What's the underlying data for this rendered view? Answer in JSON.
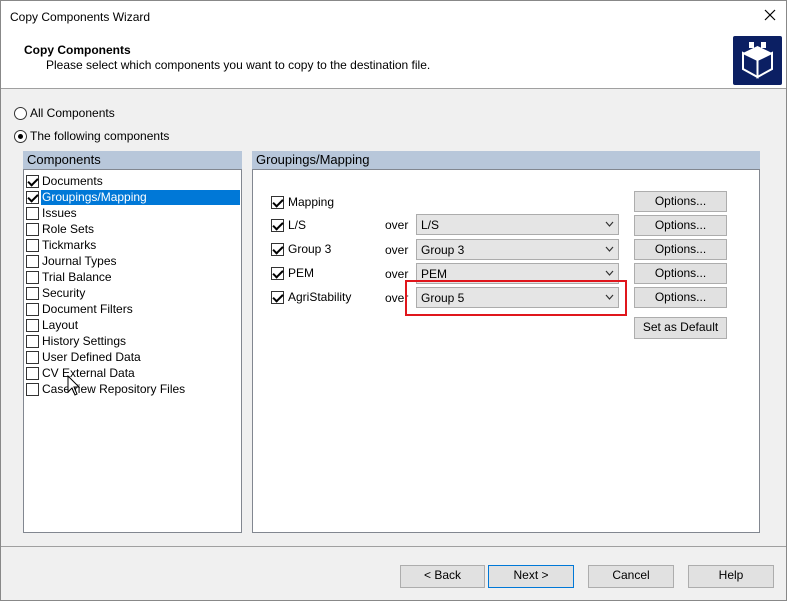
{
  "window": {
    "title": "Copy Components Wizard"
  },
  "header": {
    "title": "Copy Components",
    "subtitle": "Please select which components you want to copy to the destination file."
  },
  "scope": {
    "all_label": "All Components",
    "following_label": "The following components",
    "selected": "following"
  },
  "components": {
    "header": "Components",
    "items": [
      {
        "label": "Documents",
        "checked": true
      },
      {
        "label": "Groupings/Mapping",
        "checked": true,
        "selected": true
      },
      {
        "label": "Issues",
        "checked": false
      },
      {
        "label": "Role Sets",
        "checked": false
      },
      {
        "label": "Tickmarks",
        "checked": false
      },
      {
        "label": "Journal Types",
        "checked": false
      },
      {
        "label": "Trial Balance",
        "checked": false
      },
      {
        "label": "Security",
        "checked": false
      },
      {
        "label": "Document Filters",
        "checked": false
      },
      {
        "label": "Layout",
        "checked": false
      },
      {
        "label": "History Settings",
        "checked": false
      },
      {
        "label": "User Defined Data",
        "checked": false
      },
      {
        "label": "CV External Data",
        "checked": false
      },
      {
        "label": "CaseView Repository Files",
        "checked": false
      }
    ]
  },
  "mapping": {
    "header": "Groupings/Mapping",
    "over_label": "over",
    "options_label": "Options...",
    "set_default_label": "Set as Default",
    "rows": [
      {
        "label": "Mapping",
        "checked": true,
        "select": null
      },
      {
        "label": "L/S",
        "checked": true,
        "select": "L/S"
      },
      {
        "label": "Group 3",
        "checked": true,
        "select": "Group 3"
      },
      {
        "label": "PEM",
        "checked": true,
        "select": "PEM"
      },
      {
        "label": "AgriStability",
        "checked": true,
        "select": "Group 5"
      }
    ]
  },
  "footer": {
    "back_label": "< Back",
    "next_label": "Next >",
    "cancel_label": "Cancel",
    "help_label": "Help"
  },
  "colors": {
    "accent": "#0078d7",
    "panel_header": "#b8c7da",
    "highlight": "#e0161c",
    "logo_bg": "#0b1f63"
  }
}
